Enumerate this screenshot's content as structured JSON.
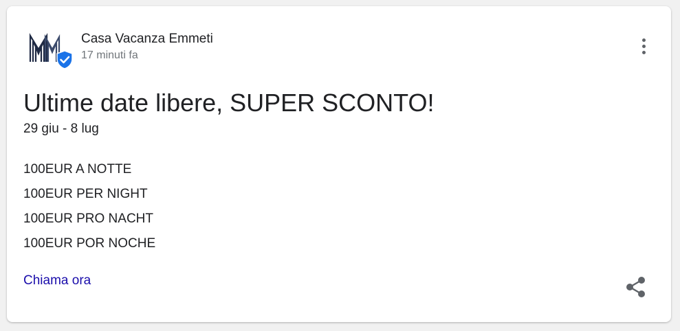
{
  "post": {
    "poster_name": "Casa Vacanza Emmeti",
    "posted_time": "17 minuti fa",
    "title": "Ultime date libere, SUPER SCONTO!",
    "date_range": "29 giu - 8 lug",
    "body_lines": [
      "100EUR A NOTTE",
      "100EUR PER NIGHT",
      "100EUR PRO NACHT",
      "100EUR POR NOCHE"
    ],
    "cta_label": "Chiama ora"
  },
  "icons": {
    "logo": "business-logo-icon",
    "verified": "verified-badge-icon",
    "more": "more-vert-icon",
    "share": "share-icon"
  },
  "colors": {
    "link": "#1a0dab",
    "verified_badge": "#1a73e8",
    "logo_dark": "#1f2a44",
    "icon_gray": "#5f6368"
  }
}
